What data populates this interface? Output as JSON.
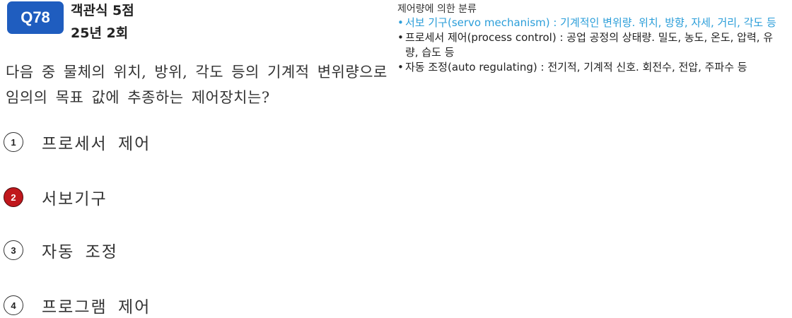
{
  "header": {
    "question_number": "Q78",
    "type_points": "객관식 5점",
    "exam": "25년 2회"
  },
  "question": {
    "text": "다음 중 물체의 위치, 방위, 각도 등의 기계적 변위량으로 임의의 목표 값에 추종하는 제어장치는?"
  },
  "choices": [
    {
      "num": "1",
      "label": "프로세서 제어",
      "correct": false
    },
    {
      "num": "2",
      "label": "서보기구",
      "correct": true
    },
    {
      "num": "3",
      "label": "자동 조정",
      "correct": false
    },
    {
      "num": "4",
      "label": "프로그램 제어",
      "correct": false
    }
  ],
  "explanation": {
    "title": "제어량에 의한 분류",
    "bullet": "•",
    "items": [
      {
        "text": "서보 기구(servo mechanism) : 기계적인 변위량. 위치, 방향, 자세, 거리, 각도 등",
        "highlight": true
      },
      {
        "text": "프로세서 제어(process control) : 공업 공정의 상태량. 밀도, 농도, 온도, 압력, 유량, 습도 등",
        "highlight": false
      },
      {
        "text": "자동 조정(auto regulating) : 전기적, 기계적 신호. 회전수, 전압, 주파수 등",
        "highlight": false
      }
    ]
  },
  "colors": {
    "badge": "#1f5dbf",
    "correct_marker": "#c0171c",
    "highlight_text": "#2b9ed9"
  }
}
